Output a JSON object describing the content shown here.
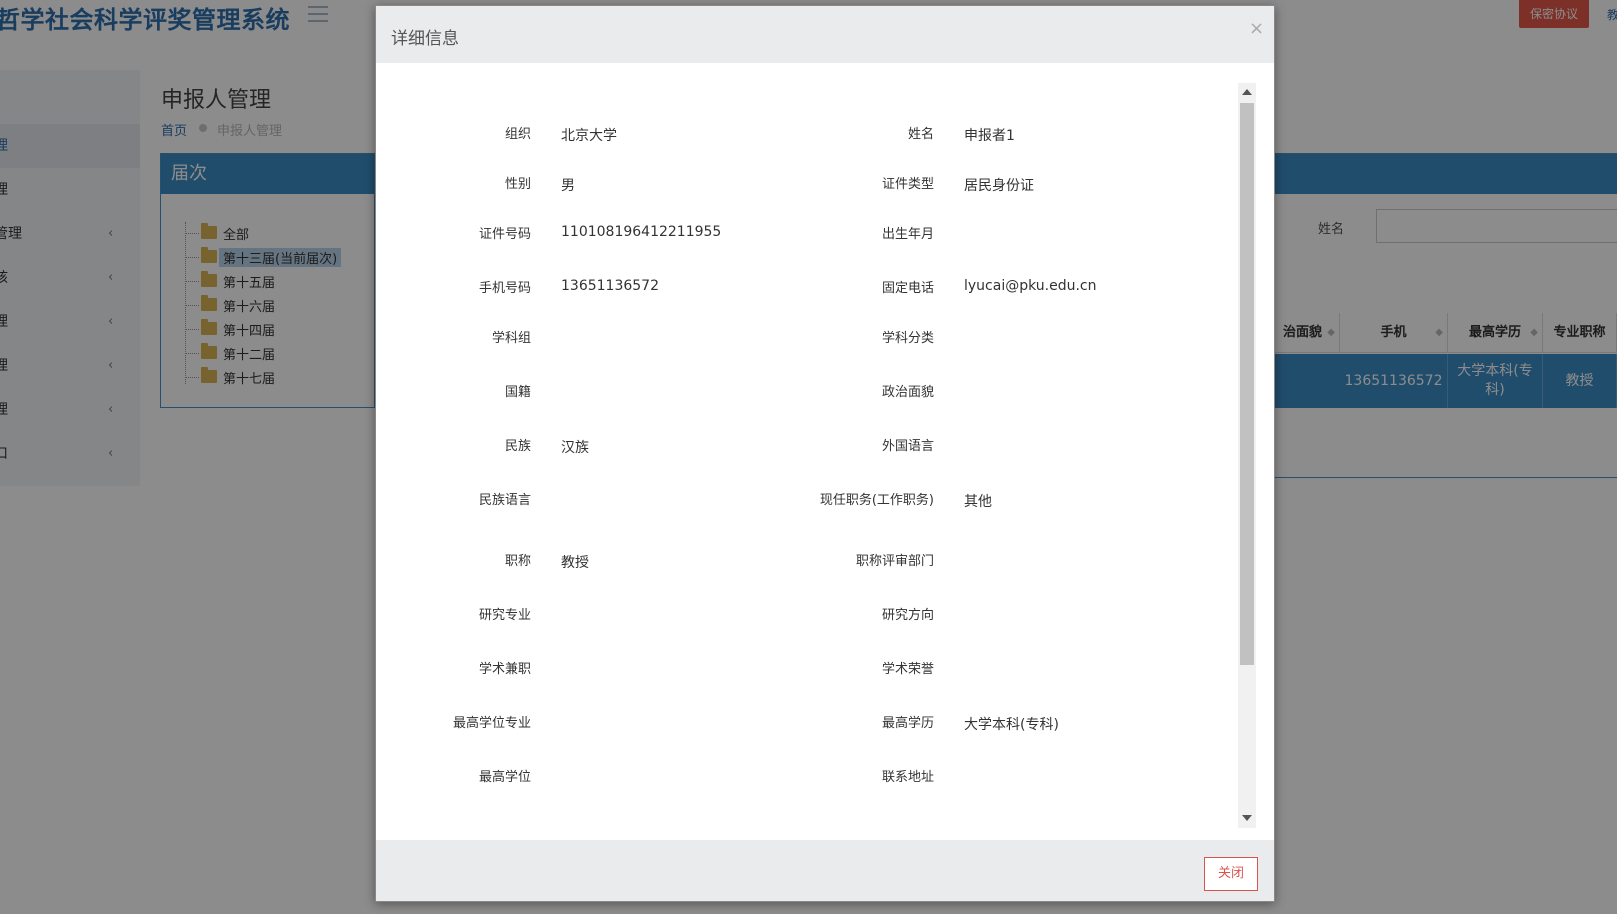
{
  "header": {
    "app_title": "哲学社会科学评奖管理系统",
    "secret_button": "保密协议",
    "right_text": "教"
  },
  "sidebar": {
    "items": [
      {
        "label": "理",
        "chevron": ""
      },
      {
        "label": "理",
        "chevron": ""
      },
      {
        "label": "管理",
        "chevron": "‹"
      },
      {
        "label": "核",
        "chevron": "‹"
      },
      {
        "label": "理",
        "chevron": "‹"
      },
      {
        "label": "理",
        "chevron": "‹"
      },
      {
        "label": "理",
        "chevron": "‹"
      },
      {
        "label": "口",
        "chevron": "‹"
      }
    ]
  },
  "page": {
    "title": "申报人管理",
    "breadcrumb_home": "首页",
    "breadcrumb_current": "申报人管理"
  },
  "tree_panel": {
    "title": "届次",
    "items": [
      "全部",
      "第十三届(当前届次)",
      "第十五届",
      "第十六届",
      "第十四届",
      "第十二届",
      "第十七届"
    ]
  },
  "main_panel": {
    "name_label": "姓名",
    "columns": [
      "治面貌",
      "手机",
      "最高学历",
      "专业职称"
    ],
    "row": {
      "phone": "13651136572",
      "education": "大学本科(专科)",
      "title": "教授"
    }
  },
  "modal": {
    "title": "详细信息",
    "close_x": "×",
    "close_button": "关闭",
    "fields_left": [
      {
        "label": "组织",
        "value": "北京大学"
      },
      {
        "label": "性别",
        "value": "男"
      },
      {
        "label": "证件号码",
        "value": "110108196412211955"
      },
      {
        "label": "手机号码",
        "value": "13651136572"
      },
      {
        "label": "学科组",
        "value": ""
      },
      {
        "label": "国籍",
        "value": ""
      },
      {
        "label": "民族",
        "value": "汉族"
      },
      {
        "label": "民族语言",
        "value": ""
      },
      {
        "label": "职称",
        "value": "教授"
      },
      {
        "label": "研究专业",
        "value": ""
      },
      {
        "label": "学术兼职",
        "value": ""
      },
      {
        "label": "最高学位专业",
        "value": ""
      },
      {
        "label": "最高学位",
        "value": ""
      }
    ],
    "fields_right": [
      {
        "label": "姓名",
        "value": "申报者1"
      },
      {
        "label": "证件类型",
        "value": "居民身份证"
      },
      {
        "label": "出生年月",
        "value": ""
      },
      {
        "label": "固定电话",
        "value": "lyucai@pku.edu.cn"
      },
      {
        "label": "学科分类",
        "value": ""
      },
      {
        "label": "政治面貌",
        "value": ""
      },
      {
        "label": "外国语言",
        "value": ""
      },
      {
        "label": "现任职务(工作职务)",
        "value": "其他"
      },
      {
        "label": "职称评审部门",
        "value": ""
      },
      {
        "label": "研究方向",
        "value": ""
      },
      {
        "label": "学术荣誉",
        "value": ""
      },
      {
        "label": "最高学历",
        "value": "大学本科(专科)"
      },
      {
        "label": "联系地址",
        "value": ""
      }
    ]
  }
}
